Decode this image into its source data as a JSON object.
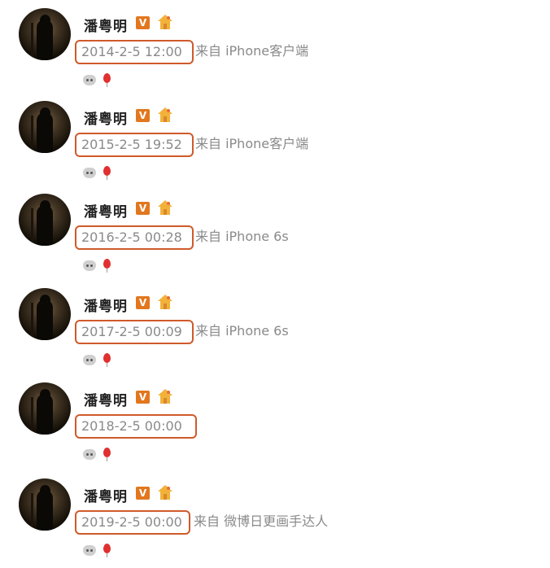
{
  "posts": [
    {
      "name": "潘粤明",
      "vip_badge": "V",
      "timestamp": "2014-2-5 12:00",
      "source": "来自 iPhone客户端"
    },
    {
      "name": "潘粤明",
      "vip_badge": "V",
      "timestamp": "2015-2-5 19:52",
      "source": "来自 iPhone客户端"
    },
    {
      "name": "潘粤明",
      "vip_badge": "V",
      "timestamp": "2016-2-5 00:28",
      "source": "来自 iPhone 6s"
    },
    {
      "name": "潘粤明",
      "vip_badge": "V",
      "timestamp": "2017-2-5 00:09",
      "source": "来自 iPhone 6s"
    },
    {
      "name": "潘粤明",
      "vip_badge": "V",
      "timestamp": "2018-2-5 00:00",
      "source": ""
    },
    {
      "name": "潘粤明",
      "vip_badge": "V",
      "timestamp": "2019-2-5 00:00",
      "source": "来自 微博日更画手达人"
    }
  ],
  "colors": {
    "highlight_box": "#d05a2a",
    "vip_badge": "#e2771f",
    "meta_text": "#8a8a8a"
  },
  "icons": {
    "level": "house-level-icon",
    "emoji_1": "cat-face-emoji-icon",
    "emoji_2": "balloon-emoji-icon"
  }
}
